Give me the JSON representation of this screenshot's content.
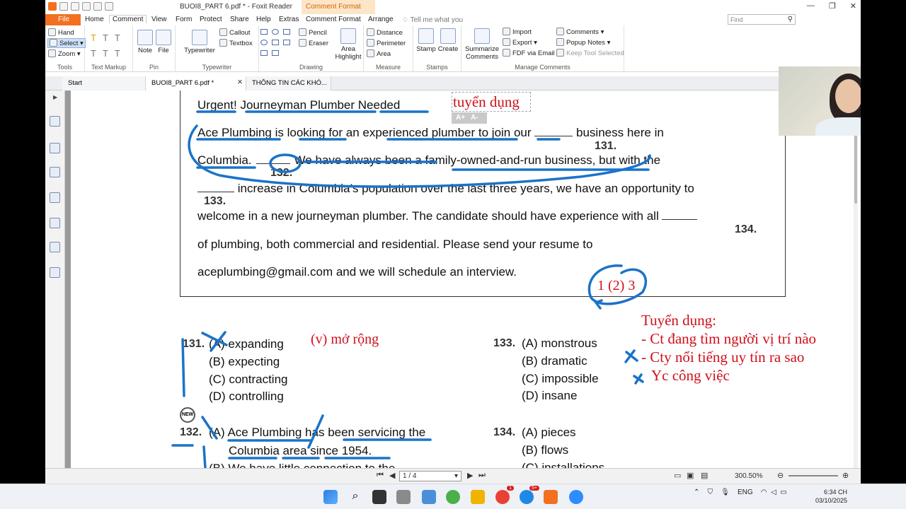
{
  "titlebar": {
    "title": "BUOI8_PART 6.pdf * - Foxit Reader",
    "context_tab": "Comment Format"
  },
  "tabs": {
    "file": "File",
    "home": "Home",
    "comment": "Comment",
    "view": "View",
    "form": "Form",
    "protect": "Protect",
    "share": "Share",
    "help": "Help",
    "extras": "Extras",
    "comment_format": "Comment Format",
    "arrange": "Arrange",
    "tell_me": "Tell me what you",
    "find_placeholder": "Find"
  },
  "ribbon": {
    "tools": {
      "label": "Tools",
      "hand": "Hand",
      "select": "Select",
      "zoom": "Zoom"
    },
    "text_markup": {
      "label": "Text Markup"
    },
    "pin": {
      "label": "Pin",
      "note": "Note",
      "file": "File"
    },
    "typewriter": {
      "label": "Typewriter",
      "typewriter": "Typewriter",
      "callout": "Callout",
      "textbox": "Textbox"
    },
    "drawing": {
      "label": "Drawing",
      "pencil": "Pencil",
      "eraser": "Eraser",
      "area_highlight": "Area Highlight"
    },
    "measure": {
      "label": "Measure",
      "distance": "Distance",
      "perimeter": "Perimeter",
      "area": "Area"
    },
    "stamps": {
      "label": "Stamps",
      "stamp": "Stamp",
      "create": "Create"
    },
    "manage": {
      "label": "Manage Comments",
      "summarize": "Summarize Comments",
      "import": "Import",
      "export": "Export",
      "fdf": "FDF via Email",
      "comments": "Comments",
      "popup": "Popup Notes",
      "keep": "Keep Tool Selected"
    }
  },
  "doc_tabs": [
    {
      "label": "Start"
    },
    {
      "label": "BUOI8_PART 6.pdf *"
    },
    {
      "label": "THÔNG TIN CÁC KHÓ..."
    }
  ],
  "passage": {
    "title": "Urgent! Journeyman Plumber Needed",
    "l1a": "Ace Plumbing is looking for an experienced plumber to join our",
    "l1b": "business here in",
    "n131": "131.",
    "l2a": "Columbia.",
    "n132": "132.",
    "l2b": "We have always been a family-owned-and-run business, but with the",
    "n133": "133.",
    "l3": "increase in Columbia’s population over the last three years, we have an opportunity to",
    "l4": "welcome in a new journeyman plumber. The candidate should have experience with all",
    "n134": "134.",
    "l5": "of plumbing, both commercial and residential. Please send your resume to",
    "l6": "aceplumbing@gmail.com and we will schedule an interview."
  },
  "questions": {
    "q131": {
      "num": "131.",
      "a": "(A) expanding",
      "b": "(B) expecting",
      "c": "(C) contracting",
      "d": "(D) controlling"
    },
    "q133": {
      "num": "133.",
      "a": "(A) monstrous",
      "b": "(B) dramatic",
      "c": "(C) impossible",
      "d": "(D) insane"
    },
    "q132": {
      "num": "132.",
      "a1": "(A) Ace Plumbing has been servicing the",
      "a2": "Columbia area since 1954.",
      "b": "(B) We have little connection to the"
    },
    "q134": {
      "num": "134.",
      "a": "(A) pieces",
      "b": "(B) flows",
      "c": "(C) installations"
    },
    "new_badge": "NEW"
  },
  "annotations": {
    "tuyen_dung": "tuyển dụng",
    "font_up": "A+",
    "font_down": "A-",
    "mo_rong": "(v) mở rộng",
    "order": "1 (2) 3",
    "note_title": "Tuyển dụng:",
    "note_1": "- Ct đang tìm người vị trí nào",
    "note_2": "- Cty nổi tiếng uy tín ra sao",
    "note_3": "Yc công việc"
  },
  "status": {
    "page": "1 / 4",
    "zoom": "300.50%"
  },
  "taskbar": {
    "lang": "ENG",
    "time": "6:34 CH",
    "date": "03/10/2025",
    "badge1": "1",
    "badge2": "5+"
  },
  "colors": {
    "accent": "#f37021",
    "ink_blue": "#1a73c9",
    "ink_red": "#d0101b"
  }
}
